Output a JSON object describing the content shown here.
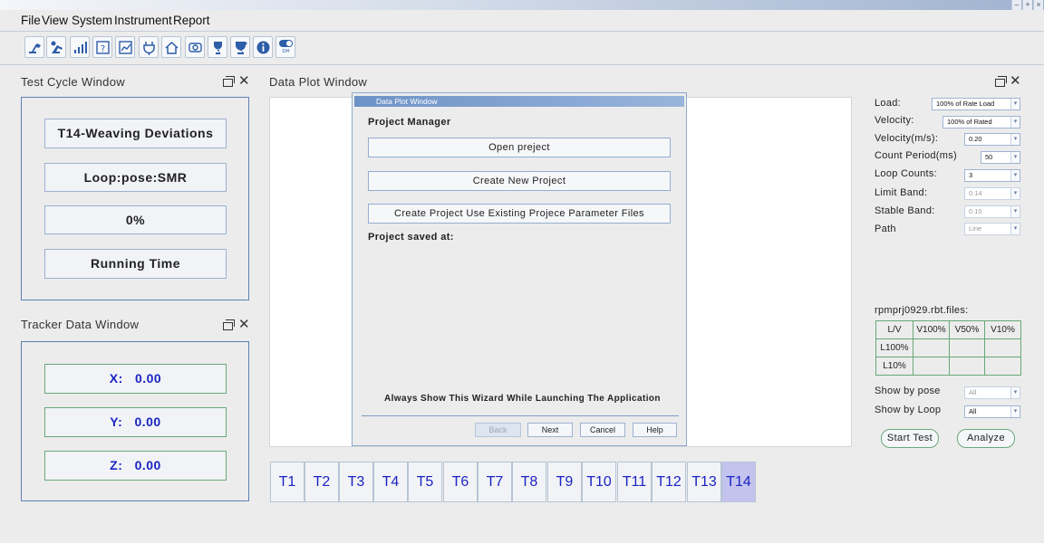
{
  "window_controls": [
    "–",
    "+",
    "×"
  ],
  "menu": [
    "File",
    "View",
    "System",
    "Instrument",
    "Report"
  ],
  "toolbar": {
    "icons": [
      "robot-arm-icon",
      "robot-teach-icon",
      "bar-chart-icon",
      "help-icon",
      "trend-chart-icon",
      "plug-icon",
      "home-icon",
      "camera-icon",
      "trophy-icon",
      "award-icon",
      "info-icon",
      "toggle-icon"
    ],
    "toggle_label": "DH"
  },
  "test_cycle": {
    "title": "Test Cycle Window",
    "buttons": [
      "T14-Weaving Deviations",
      "Loop:pose:SMR",
      "0%",
      "Running Time"
    ]
  },
  "tracker": {
    "title": "Tracker Data Window",
    "coords": [
      {
        "axis": "X:",
        "value": "0.00"
      },
      {
        "axis": "Y:",
        "value": "0.00"
      },
      {
        "axis": "Z:",
        "value": "0.00"
      }
    ]
  },
  "plot": {
    "title": "Data Plot Window"
  },
  "dialog": {
    "title": "Data Plot Window",
    "heading": "Project Manager",
    "open_label": "Open preject",
    "create_label": "Create New Project",
    "existing_label": "Create Project Use Existing Projece Parameter Files",
    "saved_label": "Project saved at:",
    "wizard_label": "Always Show This Wizard While Launching The Application",
    "back_label": "Back",
    "next_label": "Next",
    "cancel_label": "Cancel",
    "help_label": "Help"
  },
  "tabs": {
    "items": [
      "T1",
      "T2",
      "T3",
      "T4",
      "T5",
      "T6",
      "T7",
      "T8",
      "T9",
      "T10",
      "T11",
      "T12",
      "T13",
      "T14"
    ],
    "active": "T14"
  },
  "params": [
    {
      "label": "Load:",
      "value": "100% of Rate Load",
      "enabled": true
    },
    {
      "label": "Velocity:",
      "value": "100% of Rated",
      "enabled": true
    },
    {
      "label": "Velocity(m/s):",
      "value": "0.20",
      "enabled": true
    },
    {
      "label": "Count Period(ms)",
      "value": "50",
      "enabled": true
    },
    {
      "label": "Loop Counts:",
      "value": "3",
      "enabled": true
    },
    {
      "label": "Limit Band:",
      "value": "0.14",
      "enabled": false
    },
    {
      "label": "Stable Band:",
      "value": "0.10",
      "enabled": false
    },
    {
      "label": "Path",
      "value": "Line",
      "enabled": false
    }
  ],
  "files": {
    "title": "rpmprj0929.rbt.files:",
    "header": [
      "L/V",
      "V100%",
      "V50%",
      "V10%"
    ],
    "rows": [
      [
        "L100%",
        "",
        "",
        ""
      ],
      [
        "L10%",
        "",
        "",
        ""
      ]
    ]
  },
  "show_by_pose": {
    "label": "Show by pose",
    "value": "All",
    "enabled": false
  },
  "show_by_loop": {
    "label": "Show by Loop",
    "value": "All",
    "enabled": true
  },
  "actions": {
    "start": "Start Test",
    "analyze": "Analyze"
  }
}
